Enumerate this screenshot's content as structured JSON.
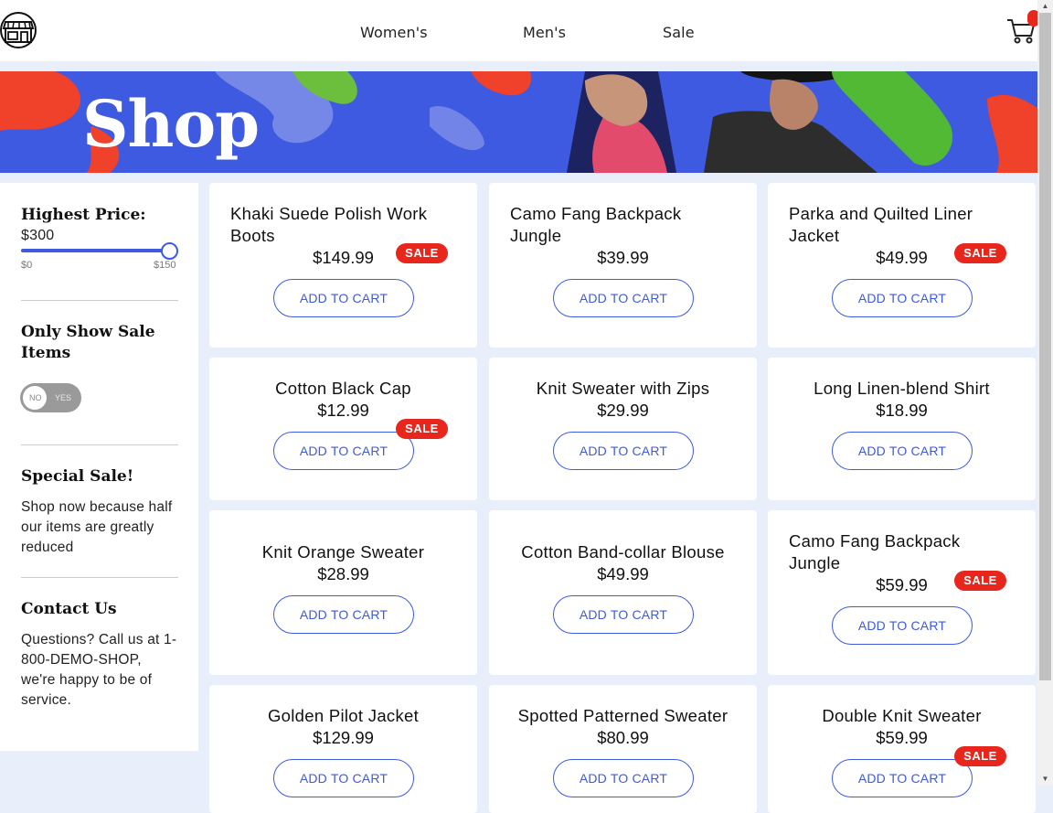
{
  "nav": {
    "links": [
      "Women's",
      "Men's",
      "Sale"
    ],
    "logo_icon": "store-icon",
    "cart_icon": "cart-icon"
  },
  "banner": {
    "title": "Shop"
  },
  "sidebar": {
    "price_filter": {
      "heading": "Highest Price:",
      "value": "$300",
      "min_label": "$0",
      "max_label": "$150",
      "level": 1.0
    },
    "sale_toggle": {
      "heading": "Only Show Sale Items",
      "off_label": "NO",
      "on_label": "YES",
      "state": "off"
    },
    "special_sale": {
      "heading": "Special Sale!",
      "text": "Shop now because half our items are greatly reduced"
    },
    "contact": {
      "heading": "Contact Us",
      "text": "Questions? Call us at 1-800-DEMO-SHOP, we're happy to be of service."
    }
  },
  "products": [
    {
      "name": "Khaki Suede Polish Work Boots",
      "price": "$149.99",
      "sale": true
    },
    {
      "name": "Camo Fang Backpack Jungle",
      "price": "$39.99",
      "sale": false
    },
    {
      "name": "Parka and Quilted Liner Jacket",
      "price": "$49.99",
      "sale": true
    },
    {
      "name": "Cotton Black Cap",
      "price": "$12.99",
      "sale": true
    },
    {
      "name": "Knit Sweater with Zips",
      "price": "$29.99",
      "sale": false
    },
    {
      "name": "Long Linen-blend Shirt",
      "price": "$18.99",
      "sale": false
    },
    {
      "name": "Knit Orange Sweater",
      "price": "$28.99",
      "sale": false
    },
    {
      "name": "Cotton Band-collar Blouse",
      "price": "$49.99",
      "sale": false
    },
    {
      "name": "Camo Fang Backpack Jungle",
      "price": "$59.99",
      "sale": true
    },
    {
      "name": "Golden Pilot Jacket",
      "price": "$129.99",
      "sale": false
    },
    {
      "name": "Spotted Patterned Sweater",
      "price": "$80.99",
      "sale": false
    },
    {
      "name": "Double Knit Sweater",
      "price": "$59.99",
      "sale": true
    }
  ],
  "labels": {
    "add_to_cart": "ADD TO CART",
    "sale_badge": "SALE"
  },
  "colors": {
    "accent": "#3d5ae0",
    "sale": "#e8261c",
    "page_bg": "#e9effa"
  }
}
